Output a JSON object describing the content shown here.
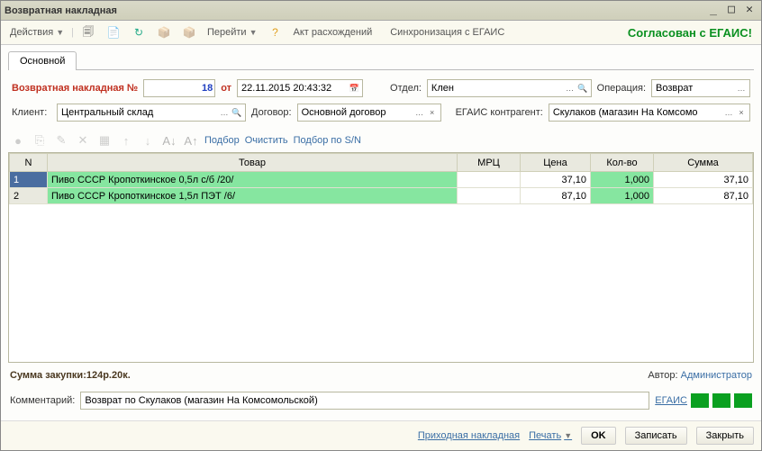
{
  "window": {
    "title": "Возвратная накладная"
  },
  "toolbar": {
    "actions": "Действия",
    "goto": "Перейти",
    "act_diff": "Акт расхождений",
    "sync_egais": "Синхронизация с ЕГАИС"
  },
  "status": "Согласован с ЕГАИС!",
  "tabs": {
    "main": "Основной"
  },
  "form": {
    "doc_label": "Возвратная накладная №",
    "doc_num": "18",
    "from_label": "от",
    "date": "22.11.2015 20:43:32",
    "department_label": "Отдел:",
    "department": "Клен",
    "operation_label": "Операция:",
    "operation": "Возврат",
    "client_label": "Клиент:",
    "client": "Центральный склад",
    "contract_label": "Договор:",
    "contract": "Основной договор",
    "egais_ctr_label": "ЕГАИС контрагент:",
    "egais_ctr": "Скулаков (магазин На Комсомо"
  },
  "grid_toolbar": {
    "podbor": "Подбор",
    "clear": "Очистить",
    "podbor_sn": "Подбор по S/N"
  },
  "grid": {
    "headers": {
      "n": "N",
      "product": "Товар",
      "mrc": "МРЦ",
      "price": "Цена",
      "qty": "Кол-во",
      "sum": "Сумма"
    },
    "rows": [
      {
        "n": "1",
        "product": "Пиво СССР  Кропоткинское 0,5л с/б /20/",
        "mrc": "",
        "price": "37,10",
        "qty": "1,000",
        "sum": "37,10"
      },
      {
        "n": "2",
        "product": "Пиво СССР Кропоткинское 1,5л ПЭТ /6/",
        "mrc": "",
        "price": "87,10",
        "qty": "1,000",
        "sum": "87,10"
      }
    ]
  },
  "summary": {
    "total_label": "Сумма закупки: ",
    "total_value": "124р.20к.",
    "author_label": "Автор: ",
    "author": "Администратор"
  },
  "comment": {
    "label": "Комментарий:",
    "value": "Возврат по Скулаков (магазин На Комсомольской)",
    "egais": "ЕГАИС"
  },
  "footer": {
    "receipt": "Приходная накладная",
    "print": "Печать",
    "ok": "OK",
    "save": "Записать",
    "close": "Закрыть"
  }
}
